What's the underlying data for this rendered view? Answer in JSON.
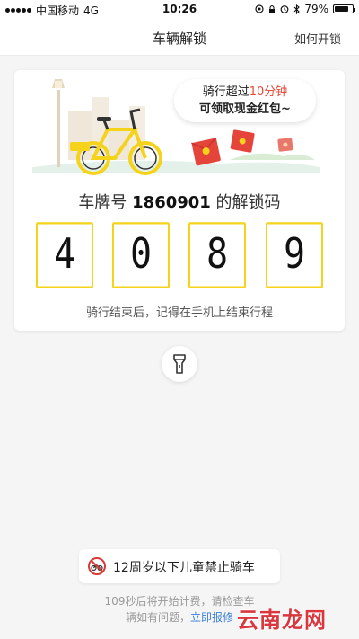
{
  "status_bar": {
    "carrier": "中国移动",
    "network": "4G",
    "time": "10:26",
    "battery": "79%",
    "battery_level": 0.79,
    "icons": [
      "signal-dots-icon",
      "location-icon",
      "lock-rotation-icon",
      "alarm-icon",
      "bluetooth-icon",
      "battery-icon"
    ]
  },
  "nav": {
    "title": "车辆解锁",
    "right_action": "如何开锁"
  },
  "card": {
    "bubble_line1_prefix": "骑行超过",
    "bubble_line1_highlight": "10分钟",
    "bubble_line2": "可领取现金红包~",
    "plate_prefix": "车牌号 ",
    "plate_number": "1860901",
    "plate_suffix": " 的解锁码",
    "unlock_code": [
      "4",
      "0",
      "8",
      "9"
    ],
    "hint": "骑行结束后，记得在手机上结束行程",
    "colors": {
      "accent_yellow": "#f4d31a",
      "highlight_red": "#e5493a"
    }
  },
  "flashlight": {
    "icon": "flashlight-icon"
  },
  "age_notice": {
    "icon": "no-bike-icon",
    "text": "12周岁以下儿童禁止骑车"
  },
  "footer": {
    "line1": "109秒后将开始计费，请检查车",
    "line2_prefix": "辆如有问题，",
    "line2_link": "立即报修"
  },
  "watermark": "云南龙网"
}
